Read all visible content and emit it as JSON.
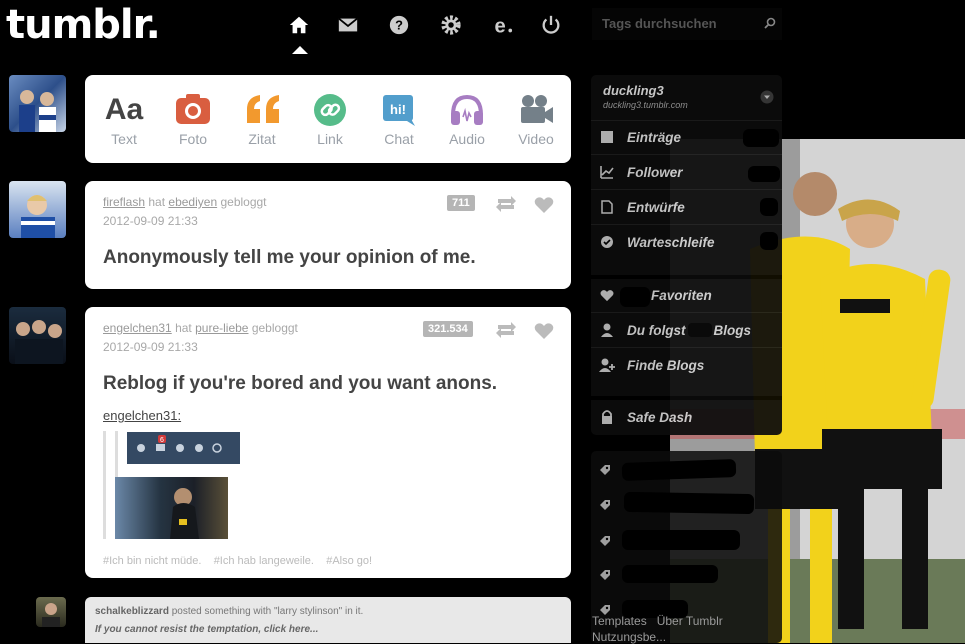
{
  "header": {
    "logo": "tumblr.",
    "nav": [
      "home-icon",
      "mail-icon",
      "help-icon",
      "settings-icon",
      "explore-icon",
      "power-icon"
    ],
    "search_placeholder": "Tags durchsuchen"
  },
  "post_types": [
    {
      "label": "Text",
      "icon": "text-icon",
      "glyph": "Aa",
      "color": "#444444"
    },
    {
      "label": "Foto",
      "icon": "camera-icon",
      "color": "#d95e40"
    },
    {
      "label": "Zitat",
      "icon": "quote-icon",
      "color": "#f2992e"
    },
    {
      "label": "Link",
      "icon": "link-icon",
      "color": "#56bc8a"
    },
    {
      "label": "Chat",
      "icon": "chat-icon",
      "glyph": "hi!",
      "color": "#529ecc"
    },
    {
      "label": "Audio",
      "icon": "headphones-icon",
      "color": "#a77dc2"
    },
    {
      "label": "Video",
      "icon": "video-icon",
      "color": "#748089"
    }
  ],
  "posts": [
    {
      "user": "fireflash",
      "verb": "hat",
      "source": "ebediyen",
      "action": "gebloggt",
      "date": "2012-09-09 21:33",
      "notes": "711",
      "title": "Anonymously tell me your opinion of me."
    },
    {
      "user": "engelchen31",
      "verb": "hat",
      "source": "pure-liebe",
      "action": "gebloggt",
      "date": "2012-09-09 21:33",
      "notes": "321.534",
      "title": "Reblog if you're bored and you want anons.",
      "quote_author": "engelchen31:",
      "embedded_badge": "6",
      "tags": [
        "#Ich bin nicht müde.",
        "#Ich hab langeweile.",
        "#Also go!"
      ]
    }
  ],
  "notice": {
    "user": "schalkeblizzard",
    "text": "posted something with \"larry stylinson\" in it.",
    "link": "If you cannot resist the temptation, click here..."
  },
  "sidebar": {
    "blog_name": "duckling3",
    "blog_url": "duckling3.tumblr.com",
    "menu": [
      {
        "label": "Einträge",
        "icon": "posts-icon"
      },
      {
        "label": "Follower",
        "icon": "chart-icon"
      },
      {
        "label": "Entwürfe",
        "icon": "draft-icon"
      },
      {
        "label": "Warteschleife",
        "icon": "queue-icon"
      }
    ],
    "favorites": "Favoriten",
    "following": "Du folgst",
    "following_suffix": "Blogs",
    "find": "Finde Blogs",
    "safe": "Safe Dash",
    "footer": [
      "Templates",
      "Über Tumblr",
      "Nutzungsbe..."
    ]
  },
  "colors": {
    "background": "#000000",
    "card": "#ffffff",
    "jersey_yellow": "#f2d21b"
  }
}
